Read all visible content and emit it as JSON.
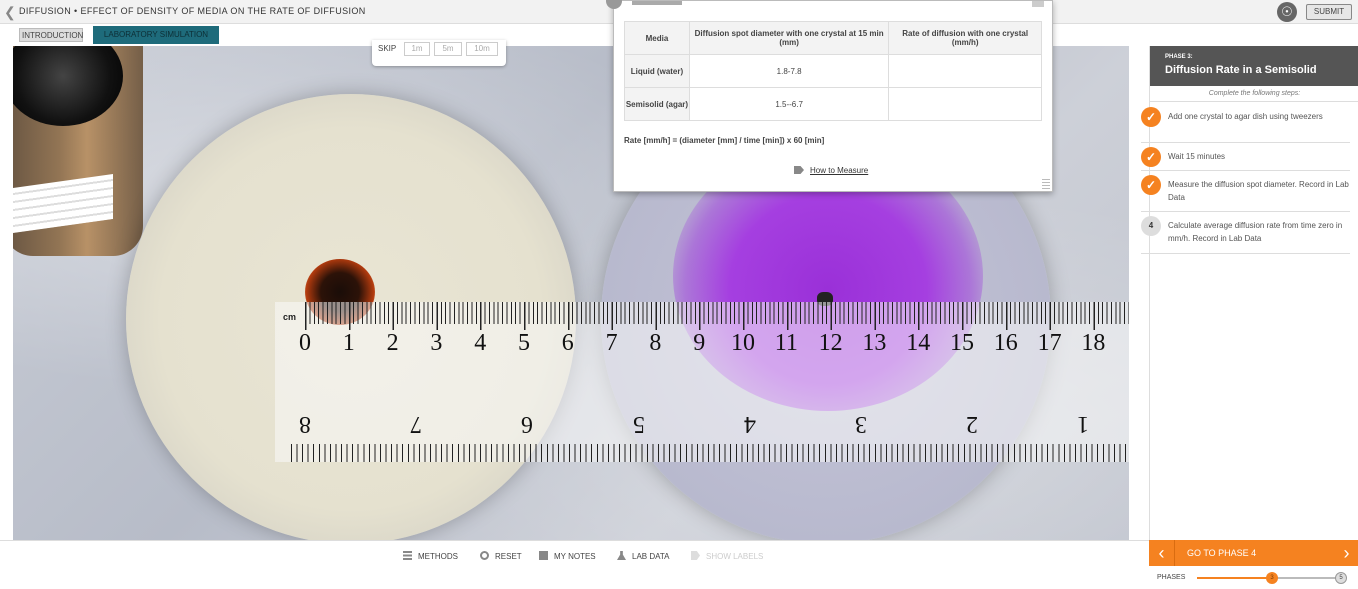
{
  "topbar": {
    "title": "DIFFUSION • EFFECT OF DENSITY OF MEDIA ON THE RATE OF DIFFUSION",
    "submit_label": "SUBMIT"
  },
  "tabs": [
    {
      "label": "INTRODUCTION",
      "active": false
    },
    {
      "label": "LABORATORY SIMULATION",
      "active": true
    }
  ],
  "skip": {
    "label": "SKIP",
    "options": [
      "1m",
      "5m",
      "10m"
    ]
  },
  "ruler": {
    "unit": "cm",
    "top_numbers": [
      "0",
      "1",
      "2",
      "3",
      "4",
      "5",
      "6",
      "7",
      "8",
      "9",
      "10",
      "11",
      "12",
      "13",
      "14",
      "15",
      "16",
      "17",
      "18"
    ],
    "bottom_numbers": [
      "8",
      "7",
      "6",
      "5",
      "4",
      "3",
      "2",
      "1"
    ]
  },
  "data_table": {
    "headers": [
      "Media",
      "Diffusion spot diameter with one crystal at 15 min (mm)",
      "Rate of diffusion with one crystal (mm/h)"
    ],
    "rows": [
      {
        "media": "Liquid (water)",
        "diameter": "1.8-7.8",
        "rate": ""
      },
      {
        "media": "Semisolid (agar)",
        "diameter": "1.5--6.7",
        "rate": ""
      }
    ],
    "formula": "Rate [mm/h] = (diameter [mm] / time [min]) x 60 [min]",
    "how_to_link": "How to Measure"
  },
  "phase": {
    "number_label": "PHASE 3:",
    "title": "Diffusion Rate in a Semisolid",
    "instructions": "Complete the following steps:",
    "steps": [
      {
        "status": "done",
        "text": "Add one crystal to agar dish using tweezers"
      },
      {
        "status": "done",
        "text": "Wait 15 minutes"
      },
      {
        "status": "done",
        "text": "Measure the diffusion spot diameter. Record in Lab Data"
      },
      {
        "status": "pending",
        "number": "4",
        "text": "Calculate average diffusion rate from time zero in mm/h. Record in Lab Data"
      }
    ]
  },
  "tools": [
    {
      "label": "METHODS",
      "enabled": true
    },
    {
      "label": "RESET",
      "enabled": true
    },
    {
      "label": "MY NOTES",
      "enabled": true
    },
    {
      "label": "LAB DATA",
      "enabled": true
    },
    {
      "label": "SHOW LABELS",
      "enabled": false
    }
  ],
  "navigation": {
    "goto_label": "GO TO PHASE 4",
    "phases_label": "PHASES",
    "current_phase": "3",
    "last_phase": "5"
  },
  "colors": {
    "accent": "#f58220",
    "tab_active": "#1e6b7b",
    "header_dark": "#555555",
    "purple_dye": "#9a30d8"
  }
}
